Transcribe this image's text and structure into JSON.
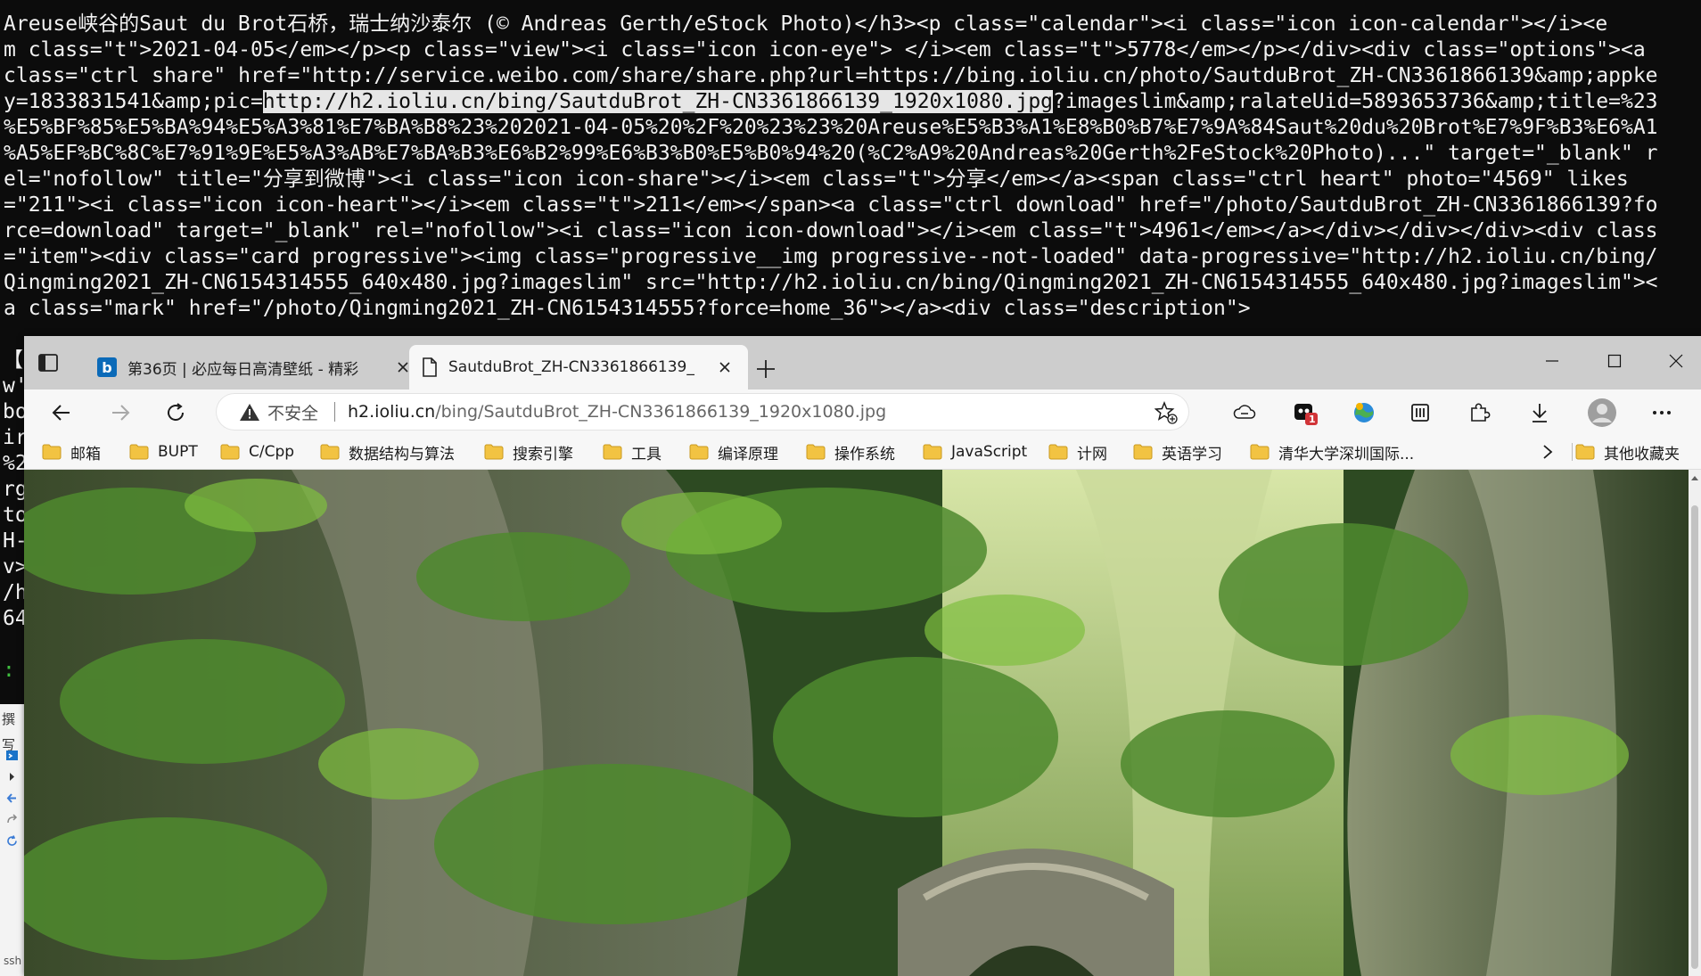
{
  "terminal": {
    "lines": [
      "Areuse峡谷的Saut du Brot石桥，瑞士纳沙泰尔 (© Andreas Gerth/eStock Photo)</h3><p class=\"calendar\"><i class=\"icon icon-calendar\"></i><e",
      "m class=\"t\">2021-04-05</em></p><p class=\"view\"><i class=\"icon icon-eye\"> </i><em class=\"t\">5778</em></p></div><div class=\"options\"><a",
      "class=\"ctrl share\" href=\"http://service.weibo.com/share/share.php?url=https://bing.ioliu.cn/photo/SautduBrot_ZH-CN3361866139&amp;appke",
      null,
      "%E5%BF%85%E5%BA%94%E5%A3%81%E7%BA%B8%23%202021-04-05%20%2F%20%23%23%20Areuse%E5%B3%A1%E8%B0%B7%E7%9A%84Saut%20du%20Brot%E7%9F%B3%E6%A1",
      "%A5%EF%BC%8C%E7%91%9E%E5%A3%AB%E7%BA%B3%E6%B2%99%E6%B3%B0%E5%B0%94%20(%C2%A9%20Andreas%20Gerth%2FeStock%20Photo)...\" target=\"_blank\" r",
      "el=\"nofollow\" title=\"分享到微博\"><i class=\"icon icon-share\"></i><em class=\"t\">分享</em></a><span class=\"ctrl heart\" photo=\"4569\" likes",
      "=\"211\"><i class=\"icon icon-heart\"></i><em class=\"t\">211</em></span><a class=\"ctrl download\" href=\"/photo/SautduBrot_ZH-CN3361866139?fo",
      "rce=download\" target=\"_blank\" rel=\"nofollow\"><i class=\"icon icon-download\"></i><em class=\"t\">4961</em></a></div></div></div><div class",
      "=\"item\"><div class=\"card progressive\"><img class=\"progressive__img progressive--not-loaded\" data-progressive=\"http://h2.ioliu.cn/bing/",
      "Qingming2021_ZH-CN6154314555_640x480.jpg?imageslim\" src=\"http://h2.ioliu.cn/bing/Qingming2021_ZH-CN6154314555_640x480.jpg?imageslim\"><",
      "a class=\"mark\" href=\"/photo/Qingming2021_ZH-CN6154314555?force=home_36\"></a><div class=\"description\">"
    ],
    "line4_before": "y=1833831541&amp;pic=",
    "line4_selected": "http://h2.ioliu.cn/bing/SautduBrot_ZH-CN3361866139_1920x1080.jpg",
    "line4_after": "?imageslim&amp;ralateUid=5893653736&amp;title=%23",
    "side_fragments": [
      "【",
      "w'",
      "bo",
      "ir",
      "%2",
      "rg",
      "to",
      "H-",
      "v>",
      "/h",
      "64",
      "",
      ":"
    ],
    "vscode_label": "撰写",
    "vscode_bottom": "ssh"
  },
  "browser": {
    "tabs": [
      {
        "title": "第36页 | 必应每日高清壁纸 - 精彩",
        "favicon": "bing-logo",
        "active": false
      },
      {
        "title": "SautduBrot_ZH-CN3361866139_",
        "favicon": "page-icon",
        "active": true
      }
    ],
    "address": {
      "security_label": "不安全",
      "host": "h2.ioliu.cn",
      "path": "/bing/SautduBrot_ZH-CN3361866139_1920x1080.jpg"
    },
    "extension_badge": "1",
    "bookmarks": [
      "邮箱",
      "BUPT",
      "C/Cpp",
      "数据结构与算法",
      "搜索引擎",
      "工具",
      "编译原理",
      "操作系统",
      "JavaScript",
      "计网",
      "英语学习",
      "清华大学深圳国际...",
      "其他收藏夹"
    ],
    "colors": {
      "tabstrip": "#cdcdcd",
      "toolbar": "#f7f7f7",
      "folder": "#f2c342",
      "bing_blue": "#0b6ab8",
      "badge_red": "#d13438"
    }
  }
}
